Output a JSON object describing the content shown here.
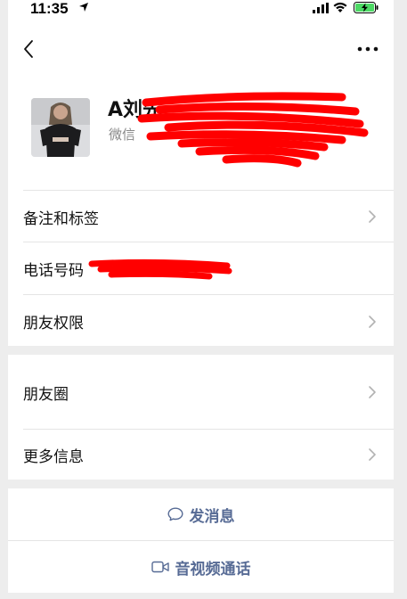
{
  "status_bar": {
    "time": "11:35"
  },
  "profile": {
    "name": "A刘先",
    "wechat_id_label": "微信"
  },
  "list_rows": {
    "remark": "备注和标签",
    "phone": "电话号码",
    "permissions": "朋友权限",
    "moments": "朋友圈",
    "more_info": "更多信息"
  },
  "actions": {
    "message": "发消息",
    "call": "音视频通话"
  },
  "colors": {
    "action_blue": "#576b95",
    "redaction_red": "#ff0000",
    "battery_green": "#4cd964"
  },
  "icons": {
    "back": "chevron-left-icon",
    "more": "ellipsis-icon",
    "row_arrow": "chevron-right-icon",
    "message": "chat-bubble-icon",
    "call": "video-camera-icon"
  }
}
